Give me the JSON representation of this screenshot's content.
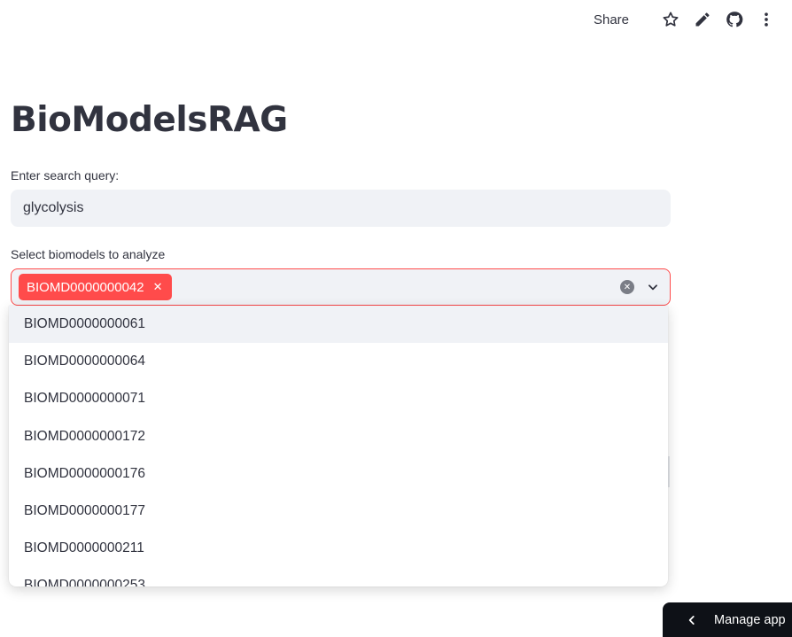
{
  "toolbar": {
    "share_label": "Share",
    "icons": [
      "star-icon",
      "edit-pencil-icon",
      "github-icon",
      "more-vertical-icon"
    ]
  },
  "page": {
    "title": "BioModelsRAG"
  },
  "search": {
    "label": "Enter search query:",
    "value": "glycolysis"
  },
  "models_select": {
    "label": "Select biomodels to analyze",
    "selected": [
      "BIOMD0000000042"
    ],
    "options": [
      "BIOMD0000000061",
      "BIOMD0000000064",
      "BIOMD0000000071",
      "BIOMD0000000172",
      "BIOMD0000000176",
      "BIOMD0000000177",
      "BIOMD0000000211",
      "BIOMD0000000253"
    ]
  },
  "manage_app": {
    "label": "Manage app"
  },
  "colors": {
    "accent": "#ff4b4b",
    "input_bg": "#f0f2f6",
    "text": "#31333f",
    "manage_bg": "#0e1117"
  }
}
